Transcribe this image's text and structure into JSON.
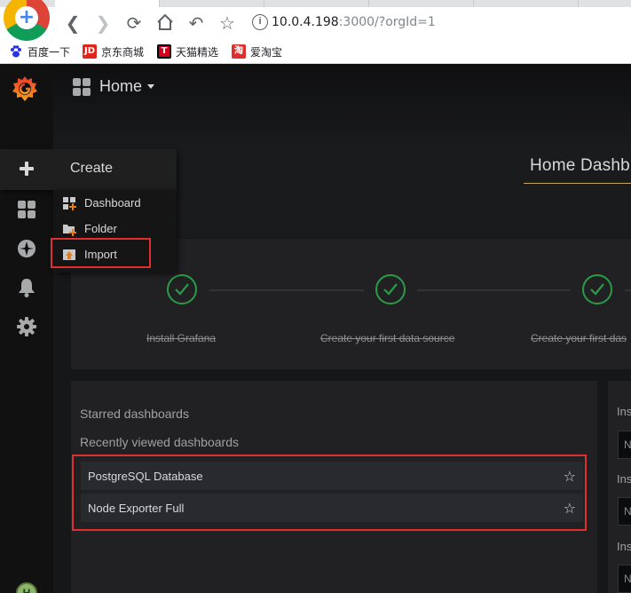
{
  "browser": {
    "url_host": "10.0.4.198",
    "url_rest": ":3000/?orgId=1",
    "bookmarks": [
      {
        "label": "百度一下",
        "icon": "baidu-paw-icon",
        "color": "#2932e1"
      },
      {
        "label": "京东商城",
        "icon": "jd-icon",
        "icon_text": "JD",
        "color": "#e1251b"
      },
      {
        "label": "天猫精选",
        "icon": "tmall-icon",
        "icon_text": "T",
        "color": "#d2001c"
      },
      {
        "label": "爱淘宝",
        "icon": "taobao-icon",
        "icon_text": "淘",
        "color": "#e02f2f"
      }
    ]
  },
  "navbar": {
    "home_label": "Home"
  },
  "dashboard": {
    "title": "Home Dashb"
  },
  "create_menu": {
    "title": "Create",
    "items": [
      {
        "label": "Dashboard",
        "icon": "dashboard-add-icon"
      },
      {
        "label": "Folder",
        "icon": "folder-add-icon"
      },
      {
        "label": "Import",
        "icon": "import-icon"
      }
    ]
  },
  "steps": [
    {
      "label": "Install Grafana",
      "done": true
    },
    {
      "label": "Create your first data source",
      "done": true
    },
    {
      "label": "Create your first das",
      "done": true
    }
  ],
  "panel": {
    "starred_label": "Starred dashboards",
    "recent_label": "Recently viewed dashboards",
    "recent_items": [
      {
        "name": "PostgreSQL Database"
      },
      {
        "name": "Node Exporter Full"
      }
    ]
  },
  "right_panel": {
    "labels": [
      "Ins",
      "Ins",
      "Ins"
    ],
    "inputs": [
      "N",
      "N",
      "N"
    ]
  },
  "colors": {
    "accent": "#eb7b18",
    "success": "#299c46",
    "highlight": "#e02f2f"
  }
}
